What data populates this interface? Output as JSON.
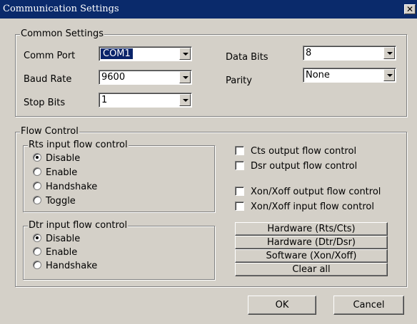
{
  "window": {
    "title": "Communication Settings",
    "close_glyph": "✕"
  },
  "common": {
    "title": "Common Settings",
    "comm_port": {
      "label": "Comm Port",
      "value": "COM1"
    },
    "baud_rate": {
      "label": "Baud Rate",
      "value": "9600"
    },
    "stop_bits": {
      "label": "Stop Bits",
      "value": "1"
    },
    "data_bits": {
      "label": "Data Bits",
      "value": "8"
    },
    "parity": {
      "label": "Parity",
      "value": "None"
    }
  },
  "flow": {
    "title": "Flow Control",
    "rts": {
      "title": "Rts input flow control",
      "options": [
        "Disable",
        "Enable",
        "Handshake",
        "Toggle"
      ],
      "selected": "Disable"
    },
    "dtr": {
      "title": "Dtr input flow control",
      "options": [
        "Disable",
        "Enable",
        "Handshake"
      ],
      "selected": "Disable"
    },
    "checks": [
      {
        "label": "Cts output flow control",
        "checked": false
      },
      {
        "label": "Dsr output flow control",
        "checked": false
      },
      {
        "label": "Xon/Xoff output flow control",
        "checked": false
      },
      {
        "label": "Xon/Xoff input flow control",
        "checked": false
      }
    ],
    "buttons": [
      "Hardware (Rts/Cts)",
      "Hardware (Dtr/Dsr)",
      "Software (Xon/Xoff)",
      "Clear all"
    ]
  },
  "dialog": {
    "ok_label": "OK",
    "cancel_label": "Cancel"
  }
}
